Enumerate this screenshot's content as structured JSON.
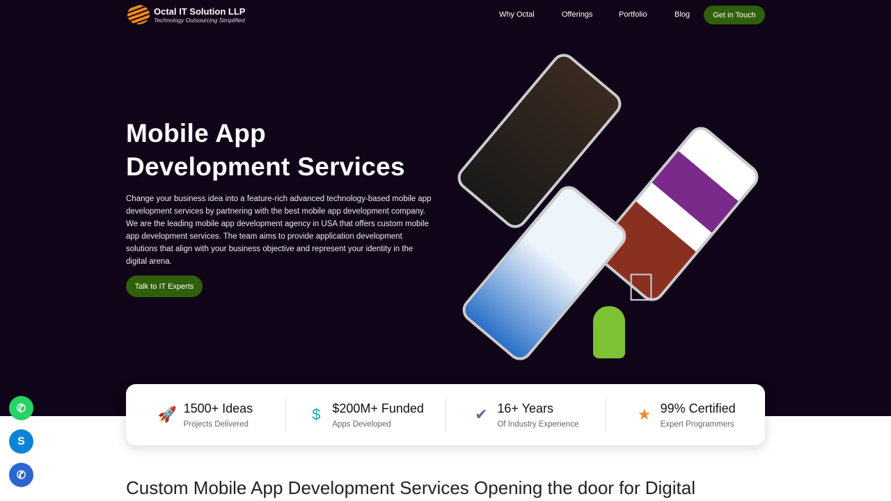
{
  "brand": {
    "name": "Octal IT Solution LLP",
    "tagline": "Technology Outsourcing Simplified"
  },
  "nav": {
    "items": [
      "Why Octal",
      "Offerings",
      "Portfolio",
      "Blog"
    ],
    "cta": "Get in Touch"
  },
  "hero": {
    "title_line1": "Mobile App",
    "title_line2": "Development Services",
    "description": "Change your business idea into a feature-rich advanced technology-based mobile app development services by partnering with the best mobile app development company. We are the leading mobile app development agency in USA that offers custom mobile app development services. The team aims to provide application development solutions that align with your business objective and represent your identity in the digital arena.",
    "button": "Talk to IT Experts"
  },
  "stats": [
    {
      "value": "1500+ Ideas",
      "label": "Projects Delivered",
      "icon": "rocket-icon"
    },
    {
      "value": "$200M+ Funded",
      "label": "Apps Developed",
      "icon": "money-bag-icon"
    },
    {
      "value": "16+ Years",
      "label": "Of Industry Experience",
      "icon": "shield-check-icon"
    },
    {
      "value": "99% Certified",
      "label": "Expert Programmers",
      "icon": "badge-icon"
    }
  ],
  "colors": {
    "hero_bg": "#100419",
    "accent": "#2f5f0a",
    "whatsapp": "#25d366",
    "skype": "#0a84d8",
    "phone": "#2d66d0"
  },
  "section": {
    "heading": "Custom Mobile App Development Services Opening the door for Digital"
  }
}
